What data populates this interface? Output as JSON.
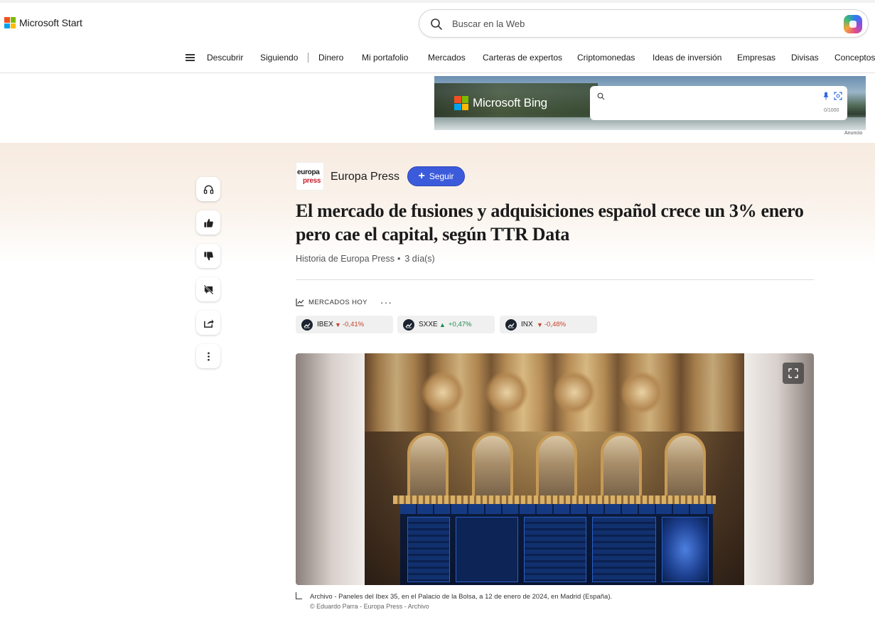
{
  "header": {
    "brand": "Microsoft Start",
    "search_placeholder": "Buscar en la Web",
    "colors": {
      "ms_red": "#f25022",
      "ms_green": "#7fba00",
      "ms_blue": "#00a4ef",
      "ms_yellow": "#ffb900"
    }
  },
  "nav": {
    "items": [
      "Descubrir",
      "Siguiendo",
      "Dinero",
      "Mi portafolio",
      "Mercados",
      "Carteras de expertos",
      "Criptomonedas",
      "Ideas de inversión",
      "Empresas",
      "Divisas",
      "Conceptos"
    ]
  },
  "ad": {
    "brand": "Microsoft Bing",
    "counter": "0/1000",
    "label": "Anuncio"
  },
  "article": {
    "publisher": "Europa Press",
    "publisher_logo_line1": "europa",
    "publisher_logo_line2": "press",
    "follow_label": "Seguir",
    "title": "El mercado de fusiones y adquisiciones español crece un 3% enero pero cae el capital, según TTR Data",
    "meta_source": "Historia de Europa Press",
    "meta_age": "3 día(s)",
    "markets_label": "MERCADOS HOY",
    "tickers": [
      {
        "symbol": "IBEX",
        "direction": "down",
        "change": "-0,41%"
      },
      {
        "symbol": "SXXE",
        "direction": "up",
        "change": "+0,47%"
      },
      {
        "symbol": "INX",
        "direction": "down",
        "change": "-0,48%"
      }
    ],
    "caption": "Archivo - Paneles del Ibex 35, en el Palacio de la Bolsa, a 12 de enero de 2024, en Madrid (España).",
    "credit": "© Eduardo Parra - Europa Press - Archivo"
  },
  "rail_icons": [
    "headphones-icon",
    "thumbs-up-icon",
    "thumbs-down-icon",
    "comment-off-icon",
    "share-icon",
    "more-vertical-icon"
  ],
  "colors": {
    "follow_button": "#3b5bdb",
    "down": "#c8432b",
    "up": "#1a8a4a"
  }
}
